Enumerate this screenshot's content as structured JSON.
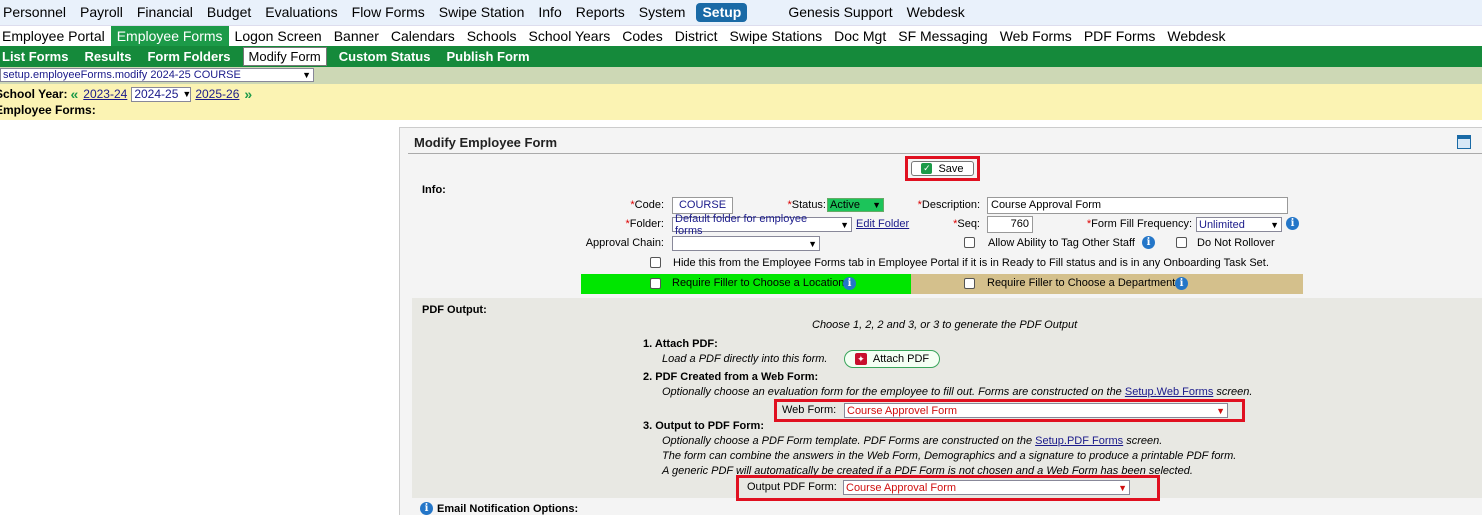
{
  "nav": {
    "top": [
      "Personnel",
      "Payroll",
      "Financial",
      "Budget",
      "Evaluations",
      "Flow Forms",
      "Swipe Station",
      "Info",
      "Reports",
      "System",
      "Setup",
      "Genesis Support",
      "Webdesk"
    ],
    "second": [
      "Employee Portal",
      "Employee Forms",
      "Logon Screen",
      "Banner",
      "Calendars",
      "Schools",
      "School Years",
      "Codes",
      "District",
      "Swipe Stations",
      "Doc Mgt",
      "SF Messaging",
      "Web Forms",
      "PDF Forms",
      "Webdesk"
    ],
    "third": [
      "List Forms",
      "Results",
      "Form Folders",
      "Modify Form",
      "Custom Status",
      "Publish Form"
    ]
  },
  "screen_select": "setup.employeeForms.modify 2024-25 COURSE",
  "school_year": {
    "label": "School Year:",
    "prev_arrow": "«",
    "prev": "2023-24",
    "current": "2024-25",
    "next": "2025-26",
    "next_arrow": "»"
  },
  "employee_forms_label": "Employee Forms:",
  "panel": {
    "title": "Modify Employee Form",
    "save_label": "Save",
    "info_label": "Info:",
    "code_label": "Code:",
    "code_value": "COURSE",
    "status_label": "Status:",
    "status_value": "Active",
    "description_label": "Description:",
    "description_value": "Course Approval Form",
    "folder_label": "Folder:",
    "folder_value": "Default folder for employee forms",
    "edit_folder": "Edit Folder",
    "seq_label": "Seq:",
    "seq_value": "760",
    "frequency_label": "Form Fill Frequency:",
    "frequency_value": "Unlimited",
    "approval_chain_label": "Approval Chain:",
    "approval_chain_value": "",
    "allow_tag_label": "Allow Ability to Tag Other Staff",
    "do_not_rollover_label": "Do Not Rollover",
    "hide_label": "Hide this from the Employee Forms tab in Employee Portal if it is in Ready to Fill status and is in any Onboarding Task Set.",
    "require_location_label": "Require Filler to Choose a Location",
    "require_department_label": "Require Filler to Choose a Department",
    "required_marker": "*"
  },
  "pdf": {
    "section_label": "PDF Output:",
    "intro": "Choose 1, 2, 2 and 3, or 3 to generate the PDF Output",
    "attach_heading": "1. Attach PDF:",
    "attach_desc": "Load a PDF directly into this form.",
    "attach_button": "Attach PDF",
    "web_heading": "2. PDF Created from a Web Form:",
    "web_desc": "Optionally choose an evaluation form for the employee to fill out. Forms are constructed on the",
    "web_link": "Setup.Web Forms",
    "web_desc_end": "screen.",
    "web_form_label": "Web Form:",
    "web_form_value": "Course Approvel Form",
    "output_heading": "3. Output to PDF Form:",
    "output_desc1": "Optionally choose a PDF Form template. PDF Forms are constructed on the",
    "output_link": "Setup.PDF Forms",
    "output_desc1_end": "screen.",
    "output_desc2": "The form can combine the answers in the Web Form, Demographics and a signature to produce a printable PDF form.",
    "output_desc3": "A generic PDF will automatically be created if a PDF Form is not chosen and a Web Form has been selected.",
    "output_pdf_label": "Output PDF Form:",
    "output_pdf_value": "Course Approval Form"
  },
  "email_label": "Email Notification Options:",
  "colors": {
    "setup_active": "#1a6aa6",
    "subnav_green": "#158a3b",
    "highlight_red": "#e01020",
    "location_bg": "#00e600",
    "department_bg": "#d4c08c"
  }
}
